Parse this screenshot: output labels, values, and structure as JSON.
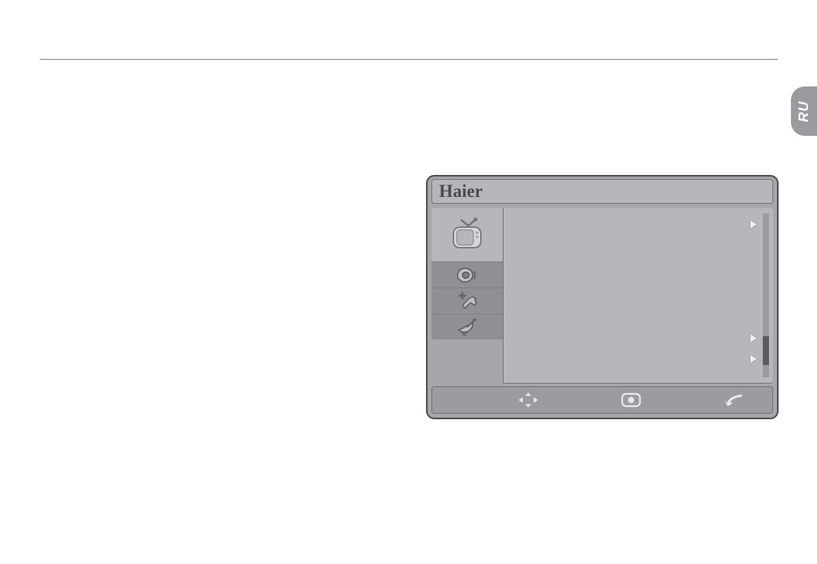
{
  "lang_tab": "RU",
  "osd": {
    "brand": "Haier",
    "sidebar": [
      {
        "name": "picture",
        "icon": "tv-icon",
        "selected": true
      },
      {
        "name": "sound",
        "icon": "speaker-icon",
        "selected": false
      },
      {
        "name": "setup",
        "icon": "wrench-plus-icon",
        "selected": false
      },
      {
        "name": "channel",
        "icon": "satellite-dish-icon",
        "selected": false
      }
    ],
    "content_arrows": [
      true,
      true,
      true
    ],
    "footer": {
      "nav_hint": "navigate",
      "select_hint": "select",
      "back_hint": "back"
    }
  }
}
